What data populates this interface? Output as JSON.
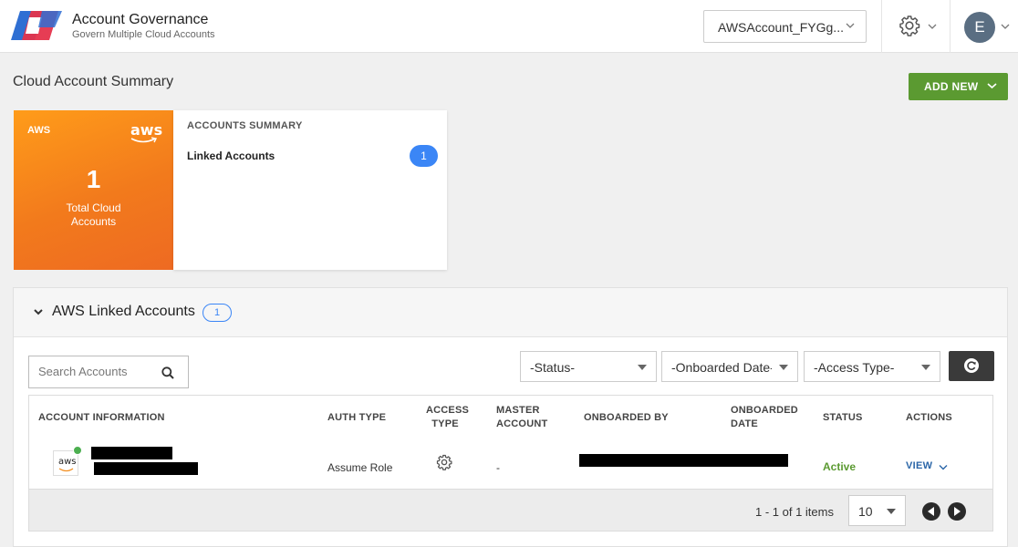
{
  "header": {
    "app_title": "Account Governance",
    "app_subtitle": "Govern Multiple Cloud Accounts",
    "account_selector": "AWSAccount_FYGg...",
    "user_initial": "E"
  },
  "page": {
    "title": "Cloud Account Summary",
    "add_new_label": "ADD NEW"
  },
  "aws_card": {
    "tag": "AWS",
    "logo_text": "aws",
    "count": "1",
    "label": "Total Cloud Accounts"
  },
  "summary_card": {
    "heading": "ACCOUNTS SUMMARY",
    "row_label": "Linked Accounts",
    "row_count": "1"
  },
  "linked_panel": {
    "title": "AWS Linked Accounts",
    "count": "1",
    "search_placeholder": "Search Accounts",
    "filters": {
      "status": "-Status-",
      "onboarded_date": "-Onboarded Date-",
      "access_type": "-Access Type-"
    }
  },
  "table": {
    "columns": {
      "account_info": "ACCOUNT INFORMATION",
      "auth_type": "AUTH TYPE",
      "access_type_1": "ACCESS",
      "access_type_2": "TYPE",
      "master_1": "MASTER",
      "master_2": "ACCOUNT",
      "onboarded_by": "ONBOARDED BY",
      "onboarded_date_1": "ONBOARDED",
      "onboarded_date_2": "DATE",
      "status": "STATUS",
      "actions": "ACTIONS"
    },
    "rows": [
      {
        "logo_text": "aws",
        "auth_type": "Assume Role",
        "master_account": "-",
        "status": "Active",
        "action": "VIEW"
      }
    ]
  },
  "pager": {
    "text": "1 - 1 of 1 items",
    "page_size": "10"
  },
  "colors": {
    "primary_green": "#5b9a31",
    "aws_orange": "#f27a1c",
    "badge_blue": "#3b86f6",
    "link_blue": "#2b66a8"
  }
}
